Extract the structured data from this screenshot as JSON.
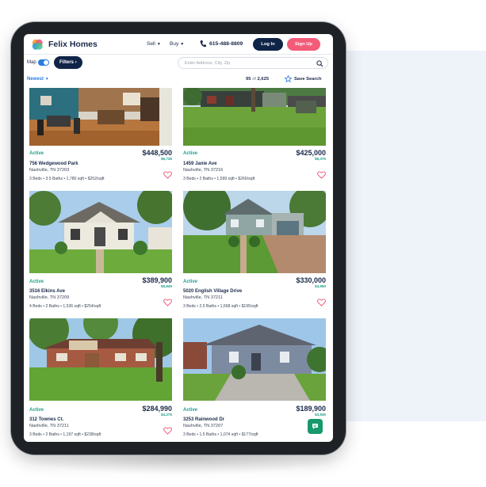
{
  "header": {
    "brand": "Felix Homes",
    "nav_sell": "Sell",
    "nav_buy": "Buy",
    "phone": "615-488-8809",
    "login_label": "Log In",
    "signup_label": "Sign Up"
  },
  "filters": {
    "map_label": "Map",
    "map_toggle_on": true,
    "filters_label": "Filters",
    "search_placeholder": "Enter Address, City, Zip"
  },
  "results": {
    "sort_label": "Newest",
    "count_shown": "95",
    "count_of": "of",
    "count_total": "2,625",
    "save_search_label": "Save Search"
  },
  "listings": [
    {
      "status": "Active",
      "price": "$448,500",
      "estimate": "$6,728",
      "address": "756 Wedgewood Park",
      "city": "Nashville, TN 37203",
      "facts": "3 Beds • 3.5 Baths • 1,780 sqft • $252/sqft"
    },
    {
      "status": "Active",
      "price": "$425,000",
      "estimate": "$6,375",
      "address": "1459 Janie Ave",
      "city": "Nashville, TN 37216",
      "facts": "3 Beds • 2 Baths • 1,599 sqft • $266/sqft"
    },
    {
      "status": "Active",
      "price": "$389,900",
      "estimate": "$5,849",
      "address": "3516 Elkins Ave",
      "city": "Nashville, TN 37209",
      "facts": "4 Beds • 2 Baths • 1,536 sqft • $254/sqft"
    },
    {
      "status": "Active",
      "price": "$330,000",
      "estimate": "$4,950",
      "address": "5020 English Village Drive",
      "city": "Nashville, TN 37211",
      "facts": "3 Beds • 2.5 Baths • 1,668 sqft • $195/sqft"
    },
    {
      "status": "Active",
      "price": "$284,990",
      "estimate": "$4,275",
      "address": "312 Townes Ct.",
      "city": "Nashville, TN 37211",
      "facts": "3 Beds • 2 Baths • 1,197 sqft • $238/sqft"
    },
    {
      "status": "Active",
      "price": "$189,900",
      "estimate": "$3,849",
      "address": "3253 Rainwood Dr",
      "city": "Nashville, TN 37207",
      "facts": "3 Beds • 1.5 Baths • 1,074 sqft • $177/sqft"
    }
  ],
  "colors": {
    "navy": "#0f2447",
    "signup_pink": "#f35b79",
    "active_green": "#1aa08a",
    "link_blue": "#2a7de1",
    "chat_green": "#17996c"
  },
  "icons": [
    "logo-icon",
    "phone-icon",
    "search-icon",
    "star-icon",
    "heart-icon",
    "chat-icon"
  ]
}
